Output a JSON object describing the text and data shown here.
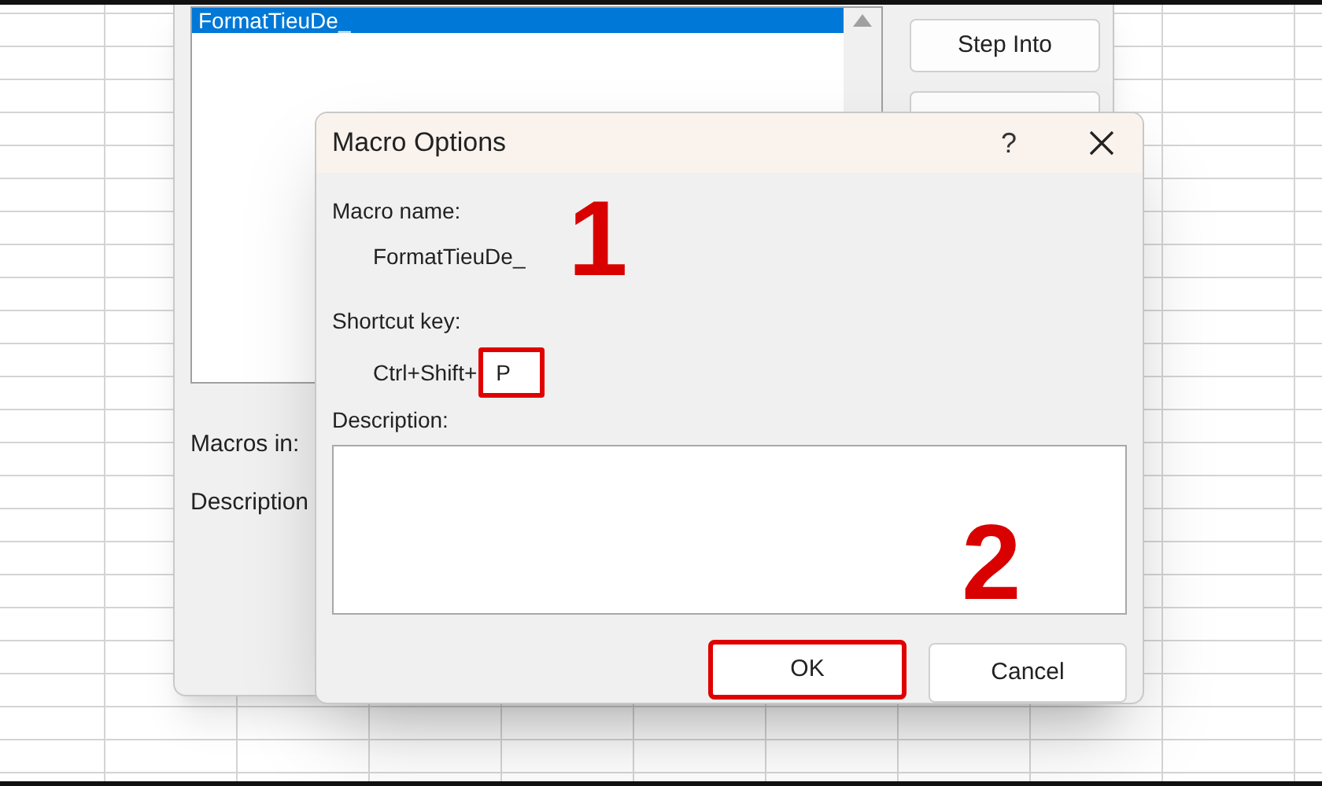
{
  "background_dialog": {
    "macro_list": [
      {
        "name": "FormatTieuDe_",
        "selected": true
      }
    ],
    "buttons": [
      {
        "label": "Step Into"
      }
    ],
    "macros_in_label": "Macros in:",
    "description_label": "Description"
  },
  "macro_options": {
    "title": "Macro Options",
    "help": "?",
    "macro_name_label": "Macro name:",
    "macro_name": "FormatTieuDe_",
    "shortcut_label": "Shortcut key:",
    "shortcut_prefix": "Ctrl+Shift+",
    "shortcut_value": "P",
    "shortcut_highlighted": true,
    "description_label": "Description:",
    "buttons": [
      {
        "label": "OK",
        "highlighted": true
      },
      {
        "label": "Cancel",
        "highlighted": false
      }
    ],
    "annotations": [
      {
        "text": "1"
      },
      {
        "text": "2"
      }
    ]
  }
}
